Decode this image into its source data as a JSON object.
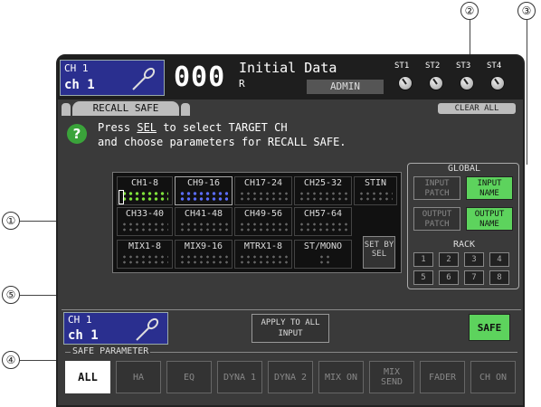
{
  "callouts": [
    "②",
    "③",
    "①",
    "⑤",
    "④"
  ],
  "header": {
    "ch_top": "CH 1",
    "ch_name": "ch 1",
    "scene_number": "000",
    "scene_title": "Initial Data",
    "scene_sub": "R",
    "user": "ADMIN",
    "st_labels": [
      "ST1",
      "ST2",
      "ST3",
      "ST4"
    ]
  },
  "tab": {
    "label": "RECALL SAFE",
    "clear_all": "CLEAR ALL"
  },
  "help": {
    "line1_a": "Press ",
    "line1_sel": "SEL",
    "line1_b": " to select TARGET CH",
    "line2": "and choose parameters for RECALL SAFE."
  },
  "grid": {
    "row1": [
      "CH1-8",
      "CH9-16",
      "CH17-24",
      "CH25-32",
      "STIN"
    ],
    "row2": [
      "CH33-40",
      "CH41-48",
      "CH49-56",
      "CH57-64"
    ],
    "row3": [
      "MIX1-8",
      "MIX9-16",
      "MTRX1-8",
      "ST/MONO"
    ],
    "set_by_sel": "SET BY SEL"
  },
  "global": {
    "title": "GLOBAL",
    "input_patch": "INPUT PATCH",
    "input_name": "INPUT NAME",
    "output_patch": "OUTPUT PATCH",
    "output_name": "OUTPUT NAME",
    "rack_title": "RACK",
    "rack": [
      "1",
      "2",
      "3",
      "4",
      "5",
      "6",
      "7",
      "8"
    ]
  },
  "bottom": {
    "ch_top": "CH 1",
    "ch_name": "ch 1",
    "apply": "APPLY TO ALL INPUT",
    "safe": "SAFE",
    "safe_param_title": "SAFE PARAMETER",
    "params": [
      "ALL",
      "HA",
      "EQ",
      "DYNA 1",
      "DYNA 2",
      "MIX ON",
      "MIX SEND",
      "FADER",
      "CH ON"
    ]
  }
}
